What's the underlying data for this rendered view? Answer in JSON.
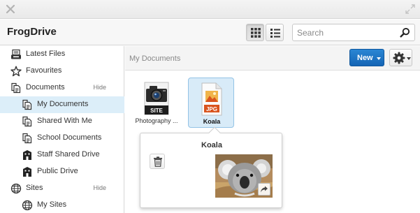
{
  "app": {
    "title": "FrogDrive"
  },
  "search": {
    "placeholder": "Search"
  },
  "view_modes": [
    "grid-view",
    "list-view"
  ],
  "sidebar": {
    "items": [
      {
        "label": "Latest Files",
        "icon": "printer-tray-icon"
      },
      {
        "label": "Favourites",
        "icon": "star-icon"
      },
      {
        "label": "Documents",
        "icon": "documents-icon",
        "action": "Hide"
      },
      {
        "label": "My Documents",
        "icon": "documents-icon",
        "selected": true
      },
      {
        "label": "Shared With Me",
        "icon": "documents-icon"
      },
      {
        "label": "School Documents",
        "icon": "documents-icon"
      },
      {
        "label": "Staff Shared Drive",
        "icon": "building-icon"
      },
      {
        "label": "Public Drive",
        "icon": "building-icon"
      },
      {
        "label": "Sites",
        "icon": "globe-icon",
        "action": "Hide"
      },
      {
        "label": "My Sites",
        "icon": "globe-icon"
      }
    ]
  },
  "content": {
    "breadcrumb": "My Documents",
    "new_label": "New",
    "files": [
      {
        "name": "Photography ...",
        "badge": "SITE",
        "type": "site"
      },
      {
        "name": "Koala",
        "badge": "JPG",
        "type": "image",
        "selected": true
      }
    ],
    "preview": {
      "title": "Koala"
    }
  },
  "colors": {
    "accent": "#1a73c8",
    "selected_bg": "#dceef9",
    "jpg_badge": "#d9541e"
  }
}
